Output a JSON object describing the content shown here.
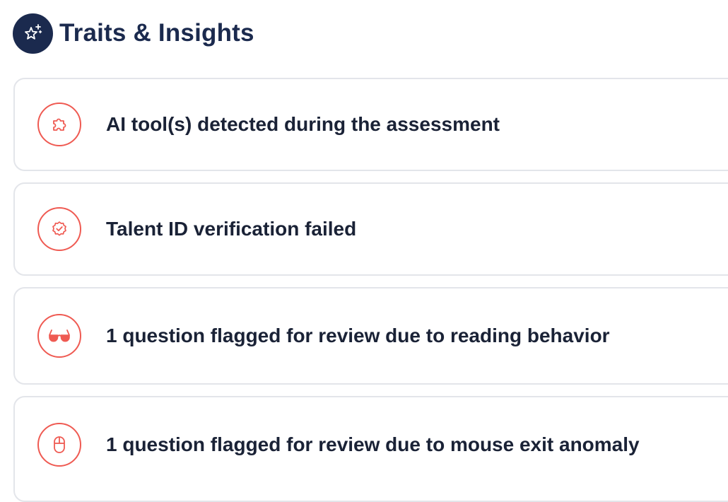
{
  "section": {
    "title": "Traits & Insights",
    "icon": "sparkle-stars-icon"
  },
  "colors": {
    "navy": "#1b2a4e",
    "alert_red": "#ef5a52",
    "card_border": "#e3e5ea"
  },
  "insights": [
    {
      "icon": "puzzle-piece-icon",
      "label": "AI tool(s) detected during the assessment"
    },
    {
      "icon": "badge-check-icon",
      "label": "Talent ID verification failed"
    },
    {
      "icon": "glasses-icon",
      "label": "1 question flagged for review due to reading behavior"
    },
    {
      "icon": "mouse-icon",
      "label": "1 question flagged for review due to mouse exit anomaly"
    }
  ]
}
